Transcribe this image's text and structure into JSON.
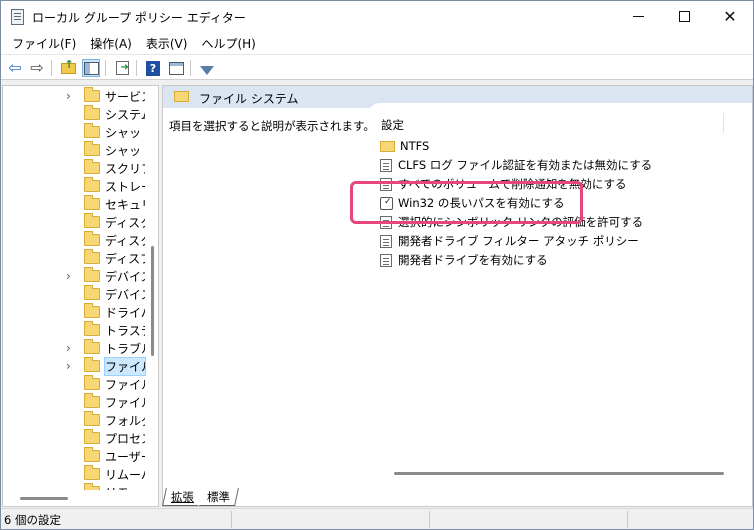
{
  "window": {
    "title": "ローカル グループ ポリシー エディター",
    "controls": {
      "minimize": "—",
      "maximize": "☐",
      "close": "✕"
    }
  },
  "menu": [
    "ファイル(F)",
    "操作(A)",
    "表示(V)",
    "ヘルプ(H)"
  ],
  "toolbar": {
    "icons": [
      "back-arrow-icon",
      "forward-arrow-icon",
      "folder-up-icon",
      "console-tree-icon",
      "export-list-icon",
      "help-icon",
      "properties-pane-icon",
      "filter-icon"
    ],
    "help_glyph": "?",
    "back_glyph": "⇦",
    "forward_glyph": "⇨"
  },
  "tree": {
    "items": [
      {
        "label": "サービス",
        "expandable": true,
        "selected": false
      },
      {
        "label": "システム",
        "expandable": false,
        "selected": false
      },
      {
        "label": "シャット",
        "expandable": false,
        "selected": false
      },
      {
        "label": "シャット",
        "expandable": false,
        "selected": false
      },
      {
        "label": "スクリプ",
        "expandable": false,
        "selected": false
      },
      {
        "label": "ストレー",
        "expandable": false,
        "selected": false
      },
      {
        "label": "セキュリ",
        "expandable": false,
        "selected": false
      },
      {
        "label": "ディスク",
        "expandable": false,
        "selected": false
      },
      {
        "label": "ディスク",
        "expandable": false,
        "selected": false
      },
      {
        "label": "ディスプ",
        "expandable": false,
        "selected": false
      },
      {
        "label": "デバイス",
        "expandable": true,
        "selected": false
      },
      {
        "label": "デバイス",
        "expandable": false,
        "selected": false
      },
      {
        "label": "ドライバ",
        "expandable": false,
        "selected": false
      },
      {
        "label": "トラステ",
        "expandable": false,
        "selected": false
      },
      {
        "label": "トラブル",
        "expandable": true,
        "selected": false
      },
      {
        "label": "ファイル",
        "expandable": true,
        "selected": true
      },
      {
        "label": "ファイル",
        "expandable": false,
        "selected": false
      },
      {
        "label": "ファイル",
        "expandable": false,
        "selected": false
      },
      {
        "label": "フォルダ",
        "expandable": false,
        "selected": false
      },
      {
        "label": "プロセス",
        "expandable": false,
        "selected": false
      },
      {
        "label": "ユーザー",
        "expandable": false,
        "selected": false
      },
      {
        "label": "リムーバ",
        "expandable": false,
        "selected": false
      },
      {
        "label": "リモート",
        "expandable": false,
        "selected": false
      }
    ],
    "chevron": "›"
  },
  "main": {
    "header_title": "ファイル システム",
    "description": "項目を選択すると説明が表示されます。",
    "column_header": "設定",
    "items": [
      {
        "label": "NTFS",
        "type": "folder"
      },
      {
        "label": "CLFS ログ ファイル認証を有効または無効にする",
        "type": "setting"
      },
      {
        "label": "すべてのボリュームで削除通知を無効にする",
        "type": "setting"
      },
      {
        "label": "Win32 の長いパスを有効にする",
        "type": "setting-enabled"
      },
      {
        "label": "選択的にシンボリック リンクの評価を許可する",
        "type": "setting"
      },
      {
        "label": "開発者ドライブ フィルター アタッチ ポリシー",
        "type": "setting"
      },
      {
        "label": "開発者ドライブを有効にする",
        "type": "setting"
      }
    ],
    "highlight_color": "#e8457a",
    "tabs": [
      "拡張",
      "標準"
    ]
  },
  "status": {
    "text": "6 個の設定"
  }
}
